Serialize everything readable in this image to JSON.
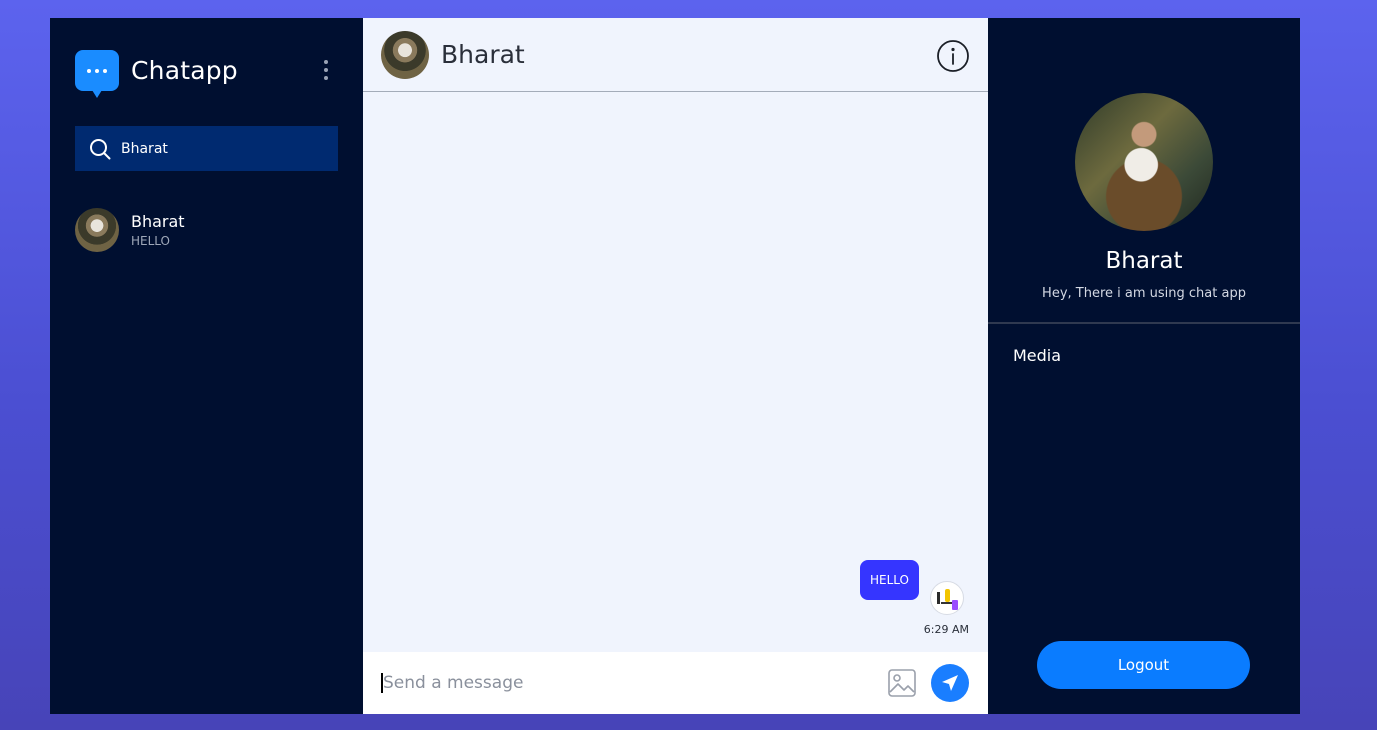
{
  "app": {
    "name": "Chatapp"
  },
  "search": {
    "value": "Bharat"
  },
  "contacts": [
    {
      "name": "Bharat",
      "last_message": "HELLO"
    }
  ],
  "chat": {
    "title": "Bharat",
    "messages": [
      {
        "text": "HELLO",
        "time": "6:29 AM",
        "sent": true
      }
    ],
    "composer_placeholder": "Send a message"
  },
  "profile": {
    "name": "Bharat",
    "status": "Hey, There i am using chat app",
    "media_label": "Media",
    "logout_label": "Logout"
  },
  "colors": {
    "background": "#5c63ee",
    "panel_dark": "#000f30",
    "search_bg": "#002a70",
    "chat_bg": "#f0f4fd",
    "accent": "#1a7eff",
    "bubble": "#3535ff"
  },
  "icons": [
    "chat-logo-icon",
    "kebab-menu-icon",
    "search-icon",
    "info-icon",
    "image-attach-icon",
    "send-icon"
  ]
}
